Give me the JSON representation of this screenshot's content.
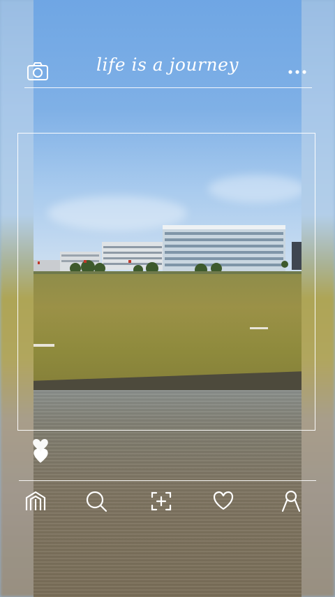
{
  "header": {
    "title": "life is a journey"
  },
  "icons": {
    "camera": "camera-icon",
    "more": "more-dots-icon",
    "like": "hearts-icon"
  },
  "bottom_nav": [
    {
      "name": "home",
      "icon": "home-icon"
    },
    {
      "name": "search",
      "icon": "search-icon"
    },
    {
      "name": "add",
      "icon": "add-post-icon"
    },
    {
      "name": "likes",
      "icon": "heart-icon"
    },
    {
      "name": "profile",
      "icon": "profile-icon"
    }
  ],
  "colors": {
    "overlay": "#ffffff",
    "sky": "#7fb0e6",
    "lawn": "#9b9147",
    "water": "#7e7461"
  }
}
